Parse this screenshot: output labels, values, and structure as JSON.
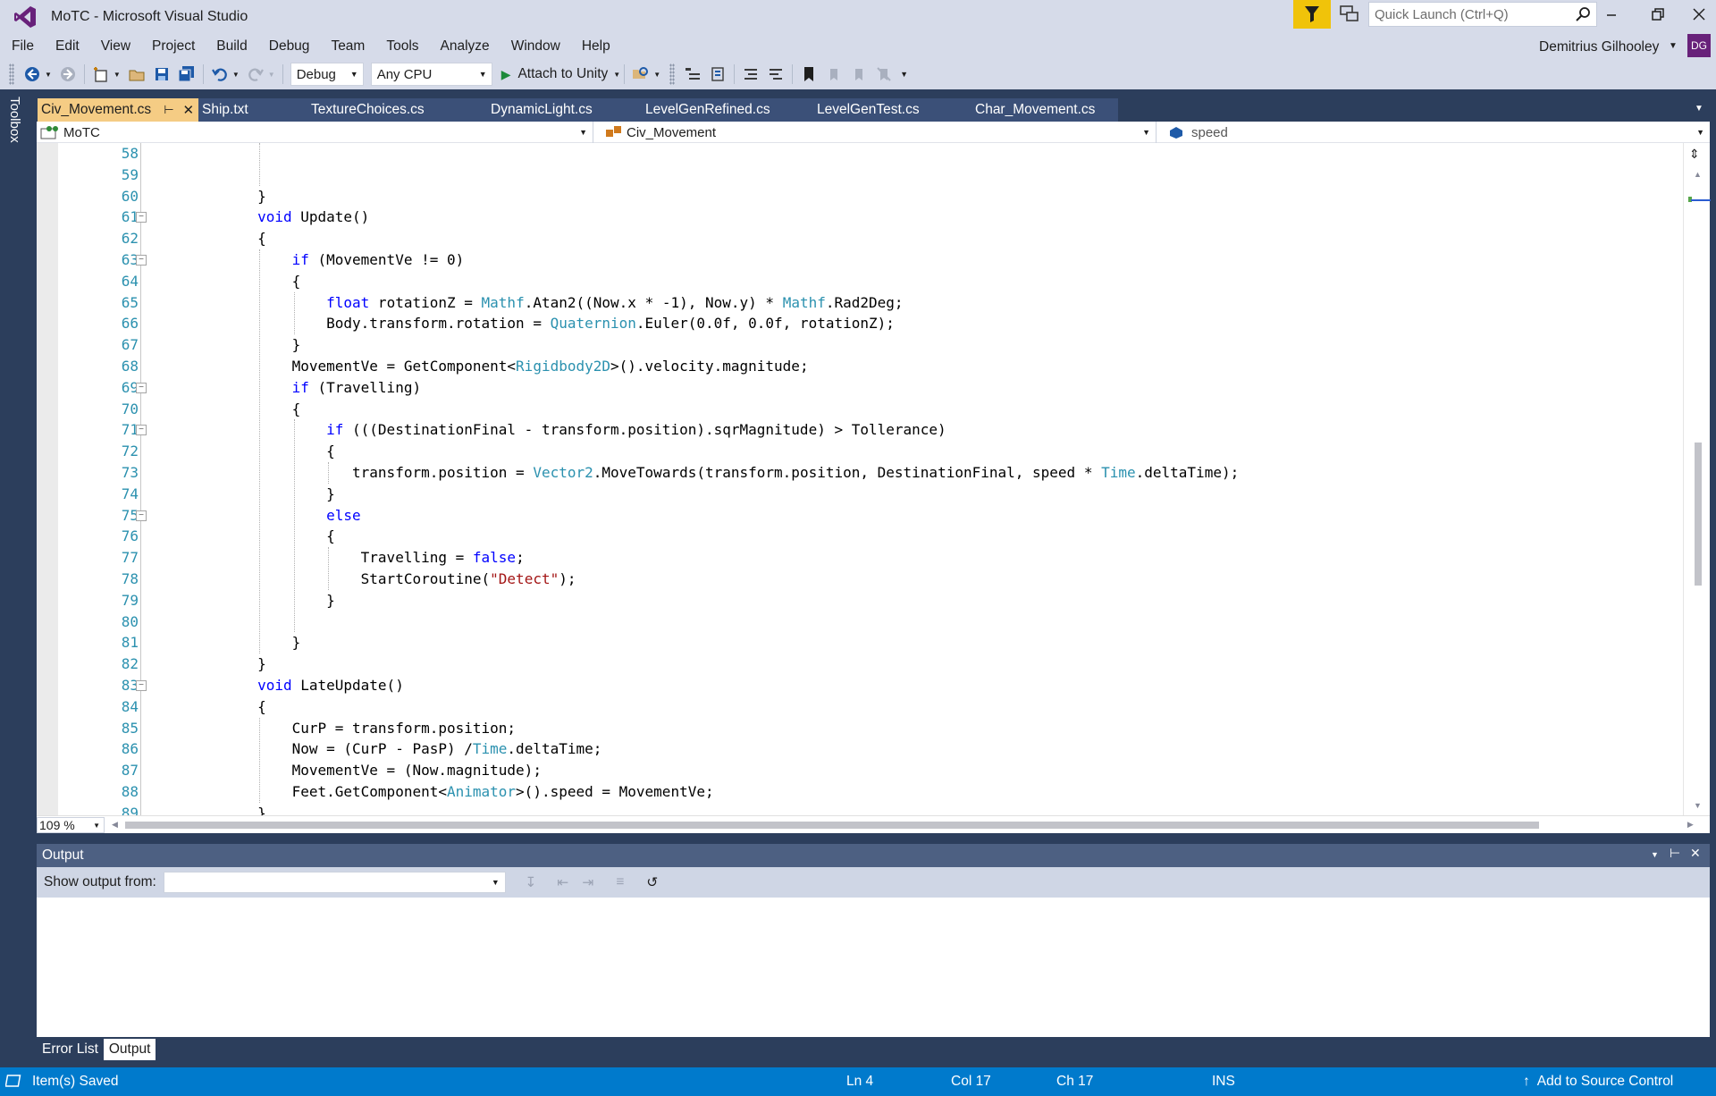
{
  "window": {
    "title": "MoTC - Microsoft Visual Studio",
    "quick_launch_placeholder": "Quick Launch (Ctrl+Q)"
  },
  "menu": [
    "File",
    "Edit",
    "View",
    "Project",
    "Build",
    "Debug",
    "Team",
    "Tools",
    "Analyze",
    "Window",
    "Help"
  ],
  "user": {
    "name": "Demitrius Gilhooley",
    "initials": "DG"
  },
  "toolbar": {
    "configuration": "Debug",
    "platform": "Any CPU",
    "attach_label": "Attach to Unity"
  },
  "toolbox_label": "Toolbox",
  "tabs": [
    {
      "label": "Civ_Movement.cs",
      "active": true
    },
    {
      "label": "Ship.txt"
    },
    {
      "label": "TextureChoices.cs"
    },
    {
      "label": "DynamicLight.cs"
    },
    {
      "label": "LevelGenRefined.cs"
    },
    {
      "label": "LevelGenTest.cs"
    },
    {
      "label": "Char_Movement.cs"
    }
  ],
  "navbar": {
    "project": "MoTC",
    "class": "Civ_Movement",
    "member": "speed"
  },
  "editor": {
    "zoom": "109 %",
    "line_numbers": [
      "58",
      "59",
      "60",
      "61",
      "62",
      "63",
      "64",
      "65",
      "66",
      "67",
      "68",
      "69",
      "70",
      "71",
      "72",
      "73",
      "74",
      "75",
      "76",
      "77",
      "78",
      "79",
      "80",
      "81",
      "82",
      "83",
      "84",
      "85",
      "86",
      "87",
      "88",
      "89"
    ],
    "fold_lines": [
      "61",
      "63",
      "69",
      "71",
      "75",
      "83"
    ],
    "code_lines": [
      [],
      [],
      [
        {
          "t": "        }"
        }
      ],
      [
        {
          "t": "        "
        },
        {
          "t": "void",
          "c": "kw"
        },
        {
          "t": " Update()"
        }
      ],
      [
        {
          "t": "        {"
        }
      ],
      [
        {
          "t": "            "
        },
        {
          "t": "if",
          "c": "kw"
        },
        {
          "t": " (MovementVe != 0)"
        }
      ],
      [
        {
          "t": "            {"
        }
      ],
      [
        {
          "t": "                "
        },
        {
          "t": "float",
          "c": "kw"
        },
        {
          "t": " rotationZ = "
        },
        {
          "t": "Mathf",
          "c": "ty"
        },
        {
          "t": ".Atan2((Now.x * -1), Now.y) * "
        },
        {
          "t": "Mathf",
          "c": "ty"
        },
        {
          "t": ".Rad2Deg;"
        }
      ],
      [
        {
          "t": "                Body.transform.rotation = "
        },
        {
          "t": "Quaternion",
          "c": "ty"
        },
        {
          "t": ".Euler(0.0f, 0.0f, rotationZ);"
        }
      ],
      [
        {
          "t": "            }"
        }
      ],
      [
        {
          "t": "            MovementVe = GetComponent<"
        },
        {
          "t": "Rigidbody2D",
          "c": "ty"
        },
        {
          "t": ">().velocity.magnitude;"
        }
      ],
      [
        {
          "t": "            "
        },
        {
          "t": "if",
          "c": "kw"
        },
        {
          "t": " (Travelling)"
        }
      ],
      [
        {
          "t": "            {"
        }
      ],
      [
        {
          "t": "                "
        },
        {
          "t": "if",
          "c": "kw"
        },
        {
          "t": " (((DestinationFinal - transform.position).sqrMagnitude) > Tollerance)"
        }
      ],
      [
        {
          "t": "                {"
        }
      ],
      [
        {
          "t": "                   transform.position = "
        },
        {
          "t": "Vector2",
          "c": "ty"
        },
        {
          "t": ".MoveTowards(transform.position, DestinationFinal, speed * "
        },
        {
          "t": "Time",
          "c": "ty"
        },
        {
          "t": ".deltaTime);"
        }
      ],
      [
        {
          "t": "                }"
        }
      ],
      [
        {
          "t": "                "
        },
        {
          "t": "else",
          "c": "kw"
        }
      ],
      [
        {
          "t": "                {"
        }
      ],
      [
        {
          "t": "                    Travelling = "
        },
        {
          "t": "false",
          "c": "kw"
        },
        {
          "t": ";"
        }
      ],
      [
        {
          "t": "                    StartCoroutine("
        },
        {
          "t": "\"Detect\"",
          "c": "str"
        },
        {
          "t": ");"
        }
      ],
      [
        {
          "t": "                }"
        }
      ],
      [],
      [
        {
          "t": "            }"
        }
      ],
      [
        {
          "t": "        }"
        }
      ],
      [
        {
          "t": "        "
        },
        {
          "t": "void",
          "c": "kw"
        },
        {
          "t": " LateUpdate()"
        }
      ],
      [
        {
          "t": "        {"
        }
      ],
      [
        {
          "t": "            CurP = transform.position;"
        }
      ],
      [
        {
          "t": "            Now = (CurP - PasP) /"
        },
        {
          "t": "Time",
          "c": "ty"
        },
        {
          "t": ".deltaTime;"
        }
      ],
      [
        {
          "t": "            MovementVe = (Now.magnitude);"
        }
      ],
      [
        {
          "t": "            Feet.GetComponent<"
        },
        {
          "t": "Animator",
          "c": "ty"
        },
        {
          "t": ">().speed = MovementVe;"
        }
      ],
      [
        {
          "t": "        }"
        }
      ]
    ]
  },
  "output": {
    "title": "Output",
    "show_output_from": "Show output from:",
    "source_value": ""
  },
  "bottom_tabs": [
    {
      "label": "Error List"
    },
    {
      "label": "Output",
      "active": true
    }
  ],
  "status": {
    "message": "Item(s) Saved",
    "ln": "Ln 4",
    "col": "Col 17",
    "ch": "Ch 17",
    "mode": "INS",
    "source_control": "Add to Source Control"
  },
  "colors": {
    "accent": "#007acc",
    "tab_active": "#f5cc84",
    "chrome": "#d6dbe9",
    "well": "#2c3e5c",
    "keyword": "#0000ff",
    "type": "#2b91af",
    "string": "#a31515"
  }
}
